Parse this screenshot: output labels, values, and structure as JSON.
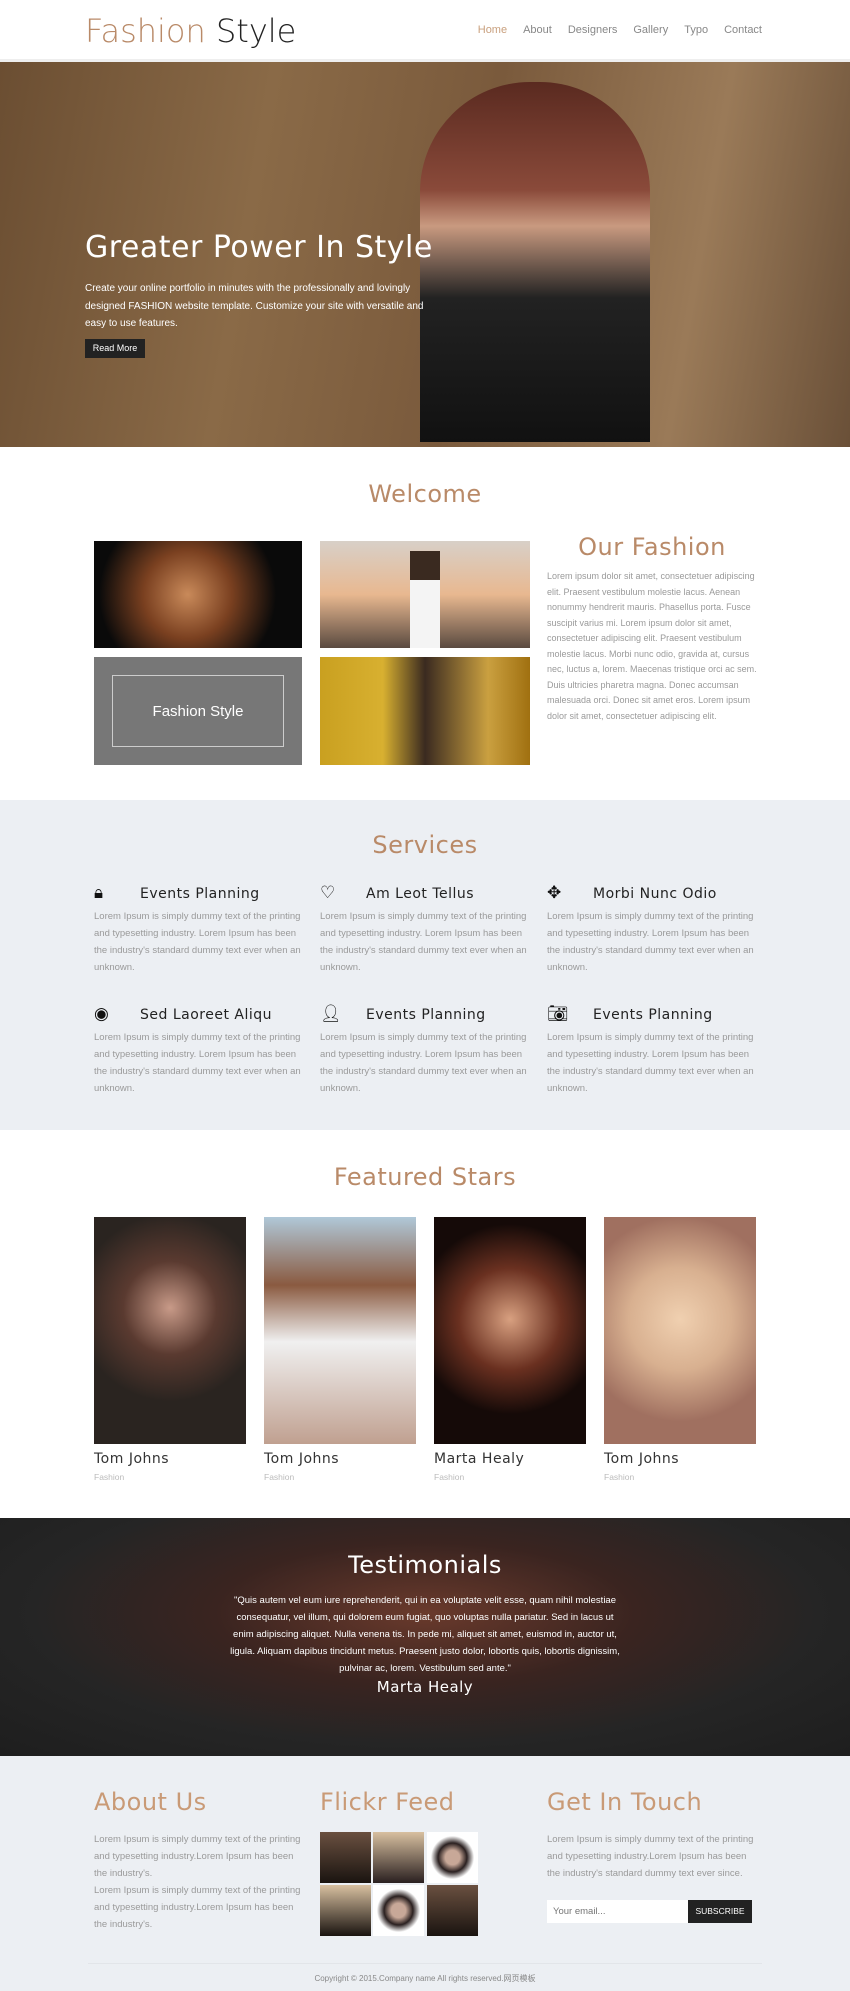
{
  "header": {
    "logo_part1": "Fashion",
    "logo_part2": "Style",
    "nav": [
      "Home",
      "About",
      "Designers",
      "Gallery",
      "Typo",
      "Contact"
    ],
    "active": "Home"
  },
  "hero": {
    "title": "Greater Power In Style",
    "text": "Create your online portfolio in minutes with the professionally and lovingly designed FASHION website template. Customize your site with versatile and easy to use features.",
    "button": "Read More"
  },
  "welcome": {
    "title": "Welcome",
    "overlay_label": "Fashion Style",
    "side_title": "Our Fashion",
    "side_text": "Lorem ipsum dolor sit amet, consectetuer adipiscing elit. Praesent vestibulum molestie lacus. Aenean nonummy hendrerit mauris. Phasellus porta. Fusce suscipit varius mi. Lorem ipsum dolor sit amet, consectetuer adipiscing elit. Praesent vestibulum molestie lacus. Morbi nunc odio, gravida at, cursus nec, luctus a, lorem. Maecenas tristique orci ac sem. Duis ultricies pharetra magna. Donec accumsan malesuada orci. Donec sit amet eros. Lorem ipsum dolor sit amet, consectetuer adipiscing elit."
  },
  "services": {
    "title": "Services",
    "items": [
      {
        "icon": "lock-icon",
        "title": "Events Planning",
        "text": "Lorem Ipsum is simply dummy text of the printing and typesetting industry. Lorem Ipsum has been the industry's standard dummy text ever when an unknown."
      },
      {
        "icon": "heart-icon",
        "title": "Am Leot Tellus",
        "text": "Lorem Ipsum is simply dummy text of the printing and typesetting industry. Lorem Ipsum has been the industry's standard dummy text ever when an unknown."
      },
      {
        "icon": "move-icon",
        "title": "Morbi Nunc Odio",
        "text": "Lorem Ipsum is simply dummy text of the printing and typesetting industry. Lorem Ipsum has been the industry's standard dummy text ever when an unknown."
      },
      {
        "icon": "eye-icon",
        "title": "Sed Laoreet Aliqu",
        "text": "Lorem Ipsum is simply dummy text of the printing and typesetting industry. Lorem Ipsum has been the industry's standard dummy text ever when an unknown."
      },
      {
        "icon": "user-icon",
        "title": "Events Planning",
        "text": "Lorem Ipsum is simply dummy text of the printing and typesetting industry. Lorem Ipsum has been the industry's standard dummy text ever when an unknown."
      },
      {
        "icon": "camera-icon",
        "title": "Events Planning",
        "text": "Lorem Ipsum is simply dummy text of the printing and typesetting industry. Lorem Ipsum has been the industry's standard dummy text ever when an unknown."
      }
    ]
  },
  "stars": {
    "title": "Featured Stars",
    "items": [
      {
        "name": "Tom Johns",
        "role": "Fashion"
      },
      {
        "name": "Tom Johns",
        "role": "Fashion"
      },
      {
        "name": "Marta Healy",
        "role": "Fashion"
      },
      {
        "name": "Tom Johns",
        "role": "Fashion"
      }
    ]
  },
  "testimonials": {
    "title": "Testimonials",
    "quote": "\"Quis autem vel eum iure reprehenderit, qui in ea voluptate velit esse, quam nihil molestiae consequatur, vel illum, qui dolorem eum fugiat, quo voluptas nulla pariatur. Sed in lacus ut enim adipiscing aliquet. Nulla venena tis. In pede mi, aliquet sit amet, euismod in, auctor ut, ligula. Aliquam dapibus tincidunt metus. Praesent justo dolor, lobortis quis, lobortis dignissim, pulvinar ac, lorem. Vestibulum sed ante.\"",
    "author": "Marta Healy"
  },
  "footer": {
    "about_title": "About Us",
    "about_text1": "Lorem Ipsum is simply dummy text of the printing and typesetting industry.Lorem Ipsum has been the industry's.",
    "about_text2": "Lorem Ipsum is simply dummy text of the printing and typesetting industry.Lorem Ipsum has been the industry's.",
    "flickr_title": "Flickr Feed",
    "contact_title": "Get In Touch",
    "contact_text": "Lorem Ipsum is simply dummy text of the printing and typesetting industry.Lorem Ipsum has been the industry's standard dummy text ever since.",
    "email_placeholder": "Your email...",
    "subscribe": "SUBSCRIBE",
    "copyright": "Copyright © 2015.Company name All rights reserved.网页模板"
  },
  "colors": {
    "accent": "#b98a68",
    "dark": "#222222",
    "section_bg": "#eceff3"
  }
}
